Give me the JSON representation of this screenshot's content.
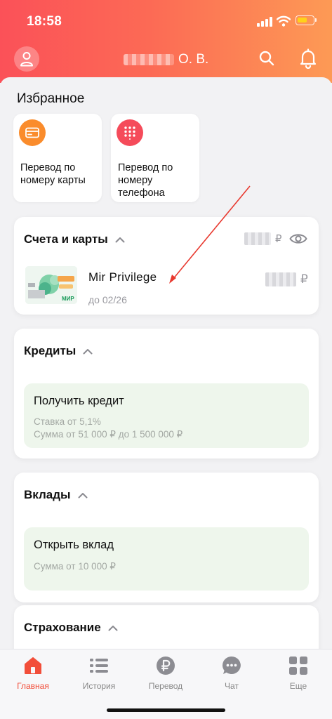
{
  "status_bar": {
    "time": "18:58"
  },
  "header": {
    "user_name_suffix": "О. В."
  },
  "favorites": {
    "title": "Избранное",
    "items": [
      {
        "label": "Перевод по номеру карты",
        "icon": "card-icon",
        "color": "#fa8c2c"
      },
      {
        "label": "Перевод по номеру телефона",
        "icon": "keypad-icon",
        "color": "#f54b5a"
      }
    ]
  },
  "accounts": {
    "title": "Счета и карты",
    "total_currency": "₽",
    "card": {
      "name": "Mir Privilege",
      "expiry": "до 02/26",
      "currency": "₽"
    }
  },
  "credits": {
    "title": "Кредиты",
    "offer": {
      "title": "Получить кредит",
      "rate": "Ставка от 5,1%",
      "amount": "Сумма от 51 000 ₽ до 1 500 000 ₽"
    }
  },
  "deposits": {
    "title": "Вклады",
    "offer": {
      "title": "Открыть вклад",
      "amount": "Сумма от 10 000 ₽"
    }
  },
  "insurance": {
    "title": "Страхование"
  },
  "tabbar": {
    "items": [
      {
        "label": "Главная",
        "icon": "home-icon",
        "active": true
      },
      {
        "label": "История",
        "icon": "history-list-icon"
      },
      {
        "label": "Перевод",
        "icon": "ruble-icon"
      },
      {
        "label": "Чат",
        "icon": "chat-icon"
      },
      {
        "label": "Еще",
        "icon": "grid-icon"
      }
    ]
  },
  "colors": {
    "accent": "#f24e3a",
    "header_start": "#fb5158",
    "header_end": "#fd9a55",
    "offer_bg": "#eef6ec"
  }
}
